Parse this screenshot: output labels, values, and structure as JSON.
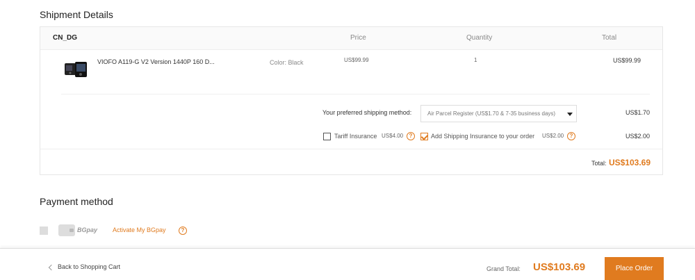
{
  "shipment": {
    "title": "Shipment Details",
    "warehouse": "CN_DG",
    "columns": {
      "price": "Price",
      "quantity": "Quantity",
      "total": "Total"
    },
    "item": {
      "name": "VIOFO A119-G V2 Version 1440P 160 D...",
      "color": "Color: Black",
      "price": "US$99.99",
      "quantity": "1",
      "total": "US$99.99"
    },
    "shipping_method": {
      "label": "Your preferred shipping method:",
      "selected": "Air Parcel Register (US$1.70 & 7-35 business days)",
      "cost": "US$1.70"
    },
    "insurance": {
      "tariff_label": "Tariff Insurance",
      "tariff_price": "US$4.00",
      "tariff_checked": false,
      "shipping_label": "Add Shipping Insurance to your order",
      "shipping_price": "US$2.00",
      "shipping_checked": true,
      "cost": "US$2.00"
    },
    "total_label": "Total:",
    "total_value": "US$103.69"
  },
  "payment": {
    "title": "Payment method",
    "option_logo": "BGpay",
    "activate_link": "Activate My BGpay"
  },
  "footer": {
    "back_link": "Back to Shopping Cart",
    "grand_total_label": "Grand Total:",
    "grand_total_value": "US$103.69",
    "place_order": "Place Order"
  },
  "colors": {
    "accent": "#e07b1f"
  }
}
